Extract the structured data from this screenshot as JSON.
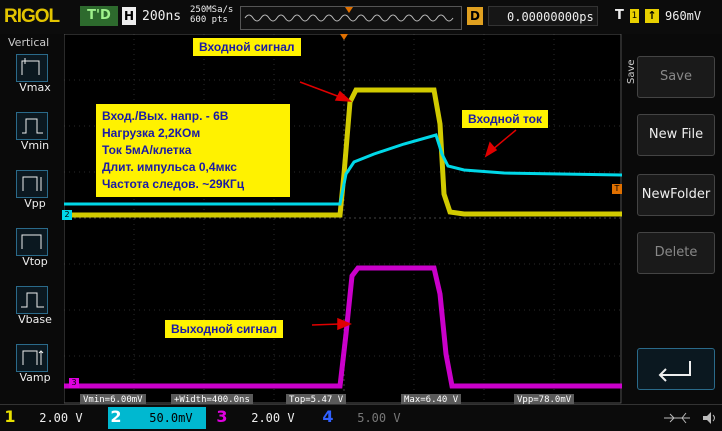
{
  "header": {
    "brand": "RIGOL",
    "trigger_status": "T'D",
    "horizontal_label": "H",
    "timebase": "200ns",
    "sample_rate": "250MSa/s",
    "memory_depth": "600 pts",
    "delay_label": "D",
    "delay_value": "0.00000000ps",
    "trigger_label": "T",
    "trigger_channel": "1",
    "trigger_level": "960mV"
  },
  "left_menu": {
    "title": "Vertical",
    "items": [
      "Vmax",
      "Vmin",
      "Vpp",
      "Vtop",
      "Vbase",
      "Vamp"
    ]
  },
  "right_menu": {
    "title": "Save",
    "items": [
      "Save",
      "New File",
      "NewFolder",
      "Delete"
    ]
  },
  "annotations": {
    "input_signal": "Входной сигнал",
    "input_current": "Входной ток",
    "output_signal": "Выходной сигнал",
    "info_lines": [
      "Вход./Вых. напр. - 6В",
      "Нагрузка 2,2КОм",
      "Ток  5мА/клетка",
      "Длит. импульса 0,4мкс",
      "Частота следов. ~29КГц"
    ]
  },
  "measurements": [
    "Vmin=6.00mV",
    "+Width=400.0ns",
    "Top=5.47 V",
    "Max=6.40 V",
    "Vpp=78.0mV"
  ],
  "channels": [
    {
      "num": "1",
      "scale": "2.00 V",
      "color": "#e8e000"
    },
    {
      "num": "2",
      "scale": "50.0mV",
      "color": "#00e0f0"
    },
    {
      "num": "3",
      "scale": "2.00 V",
      "color": "#e000e0"
    },
    {
      "num": "4",
      "scale": "5.00 V",
      "color": "#3060ff"
    }
  ],
  "channel_markers": {
    "ch2": "2",
    "ch3": "3"
  },
  "colors": {
    "ch1": "#e8e000",
    "ch2": "#00d8e8",
    "ch3": "#e000e0",
    "annotation_bg": "#fff200",
    "annotation_text": "#1a1aa6",
    "arrow": "#e00000"
  }
}
